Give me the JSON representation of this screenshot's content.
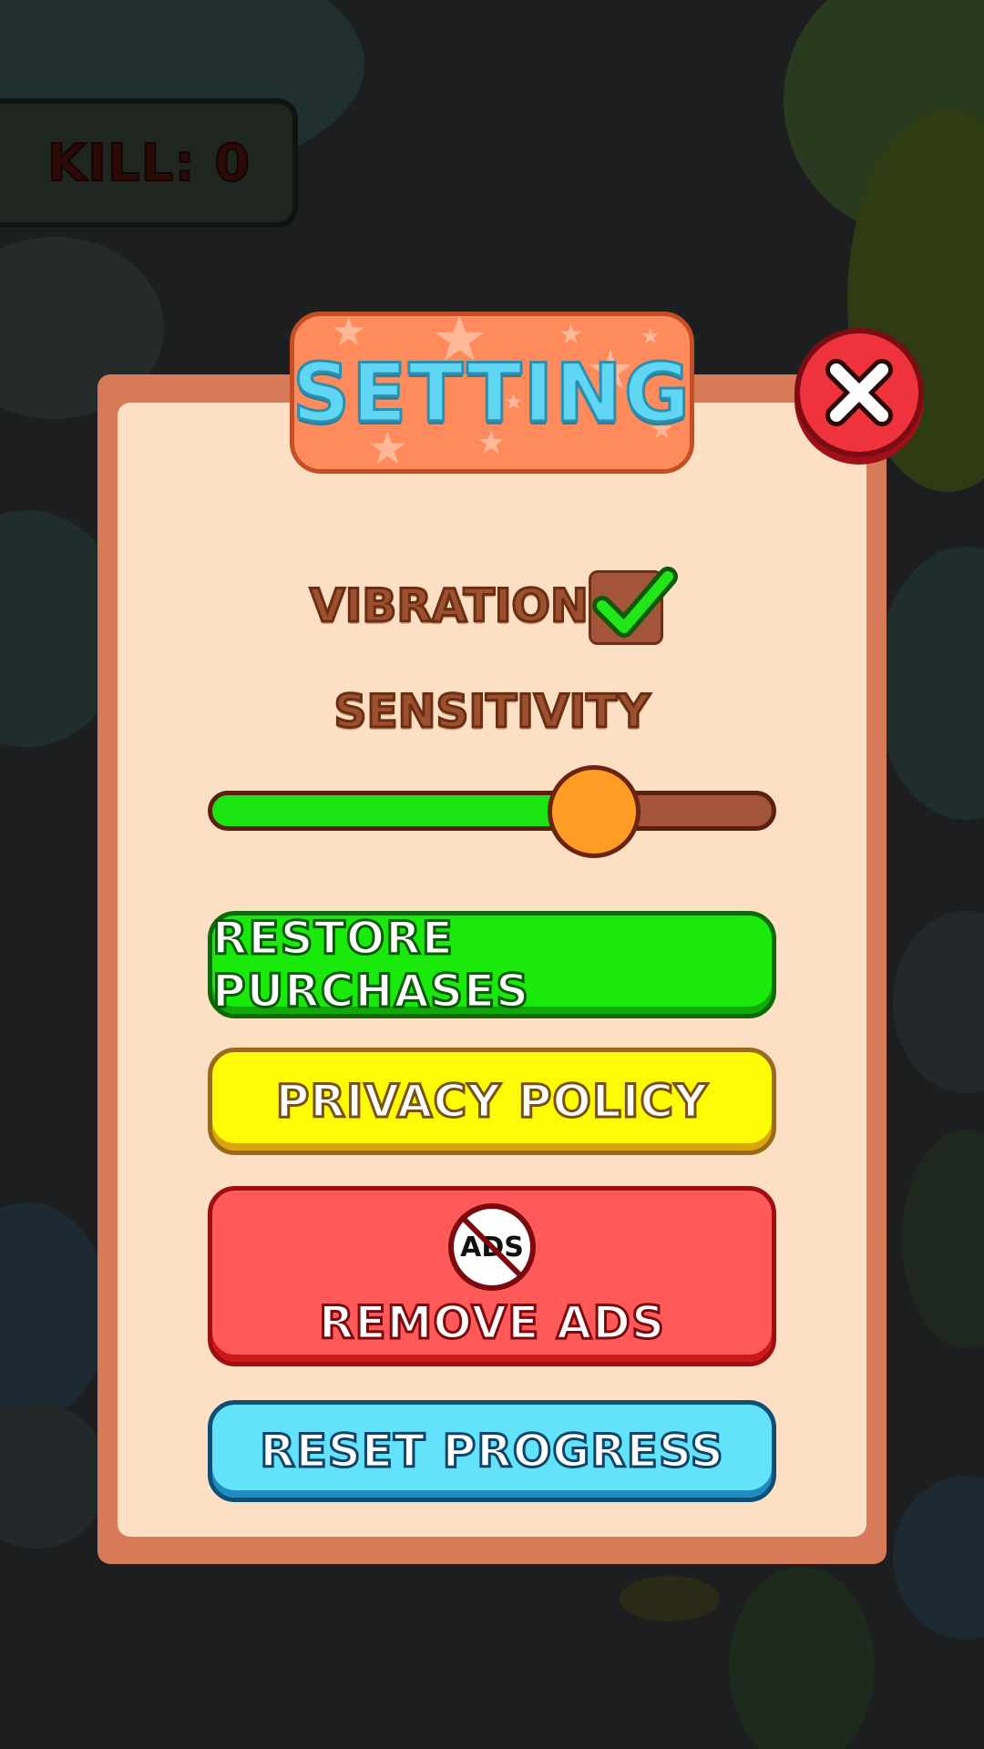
{
  "hud": {
    "kill_label": "KILL: 0"
  },
  "dialog": {
    "title": "SETTING",
    "close_icon": "close-x-icon"
  },
  "settings": {
    "vibration_label": "VIBRATION",
    "vibration_enabled": true,
    "sensitivity_label": "SENSITIVITY",
    "sensitivity_level": 0.68
  },
  "buttons": {
    "restore_purchases": "RESTORE PURCHASES",
    "privacy_policy": "PRIVACY POLICY",
    "ads_badge": "ADS",
    "remove_ads": "REMOVE ADS",
    "reset_progress": "RESET PROGRESS"
  },
  "colors": {
    "panel_border": "#d77a57",
    "panel_fill": "#fde0c4",
    "restore": "#19ea0c",
    "privacy": "#fffa05",
    "remove_ads": "#ff5a59",
    "reset": "#62e3fb",
    "slider_fill": "#1ae512",
    "slider_knob": "#ff9c24"
  }
}
